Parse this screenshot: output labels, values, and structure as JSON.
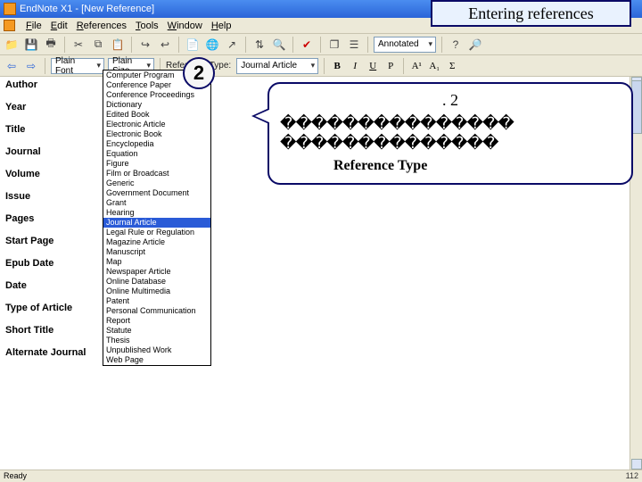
{
  "title": "EndNote X1 - [New Reference]",
  "menu": [
    "File",
    "Edit",
    "References",
    "Tools",
    "Window",
    "Help"
  ],
  "tb1": {
    "annotated": "Annotated",
    "help_icon": "?",
    "binoc_icon": "⌕"
  },
  "tb2": {
    "fontname": "Plain Font",
    "fontsize": "Plain Size",
    "reftype_label": "Reference Type:",
    "reftype_value": "Journal Article",
    "btns": {
      "b": "B",
      "i": "I",
      "u": "U",
      "p": "P",
      "a1": "A¹",
      "a2": "A₁",
      "sigma": "Σ"
    }
  },
  "fields": [
    "Author",
    "Year",
    "Title",
    "Journal",
    "Volume",
    "Issue",
    "Pages",
    "Start Page",
    "Epub Date",
    "Date",
    "Type of Article",
    "Short Title",
    "Alternate Journal"
  ],
  "dropdown": {
    "items": [
      "Computer Program",
      "Conference Paper",
      "Conference Proceedings",
      "Dictionary",
      "Edited Book",
      "Electronic Article",
      "Electronic Book",
      "Encyclopedia",
      "Equation",
      "Figure",
      "Film or Broadcast",
      "Generic",
      "Government Document",
      "Grant",
      "Hearing",
      "Journal Article",
      "Legal Rule or Regulation",
      "Magazine Article",
      "Manuscript",
      "Map",
      "Newspaper Article",
      "Online Database",
      "Online Multimedia",
      "Patent",
      "Personal Communication",
      "Report",
      "Statute",
      "Thesis",
      "Unpublished Work",
      "Web Page"
    ],
    "selected_index": 15
  },
  "slide_header": "Entering references",
  "callout_num": "2",
  "bubble": {
    "num": ". 2",
    "line1": "���������������",
    "line2": "��������������",
    "ref": "Reference Type"
  },
  "status": {
    "left": "Ready",
    "right": "112"
  }
}
